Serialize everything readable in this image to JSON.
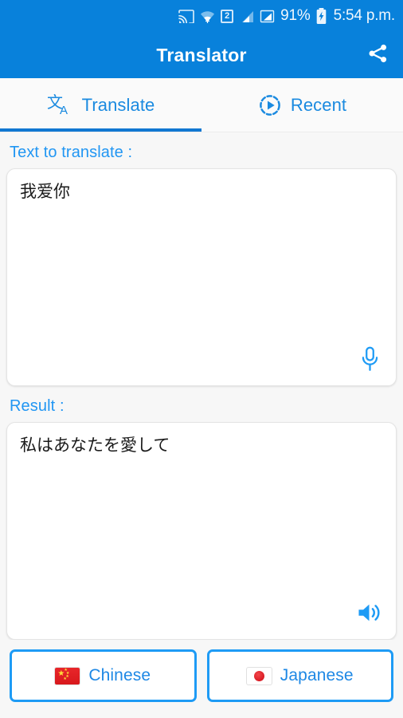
{
  "status_bar": {
    "icons": [
      "cast-icon",
      "wifi-icon",
      "sim-icon",
      "signal-icon",
      "signal-alt-icon"
    ],
    "sim_label": "2",
    "battery_percent": "91%",
    "battery_state": "charging",
    "time": "5:54 p.m."
  },
  "app_bar": {
    "title": "Translator",
    "share_icon": "share-icon"
  },
  "tabs": [
    {
      "label": "Translate",
      "icon": "translate-icon",
      "active": true
    },
    {
      "label": "Recent",
      "icon": "history-icon",
      "active": false
    }
  ],
  "source": {
    "label": "Text to translate :",
    "value": "我爱你",
    "placeholder": "",
    "action_icon": "microphone-icon"
  },
  "result": {
    "label": "Result :",
    "value": "私はあなたを愛して",
    "placeholder": "",
    "action_icon": "speaker-icon"
  },
  "languages": {
    "source": {
      "name": "Chinese",
      "flag": "flag-china"
    },
    "target": {
      "name": "Japanese",
      "flag": "flag-japan"
    }
  },
  "colors": {
    "primary": "#0881db",
    "accent": "#1e9bf5",
    "label": "#2196f3",
    "background": "#f7f7f7",
    "card": "#ffffff"
  }
}
